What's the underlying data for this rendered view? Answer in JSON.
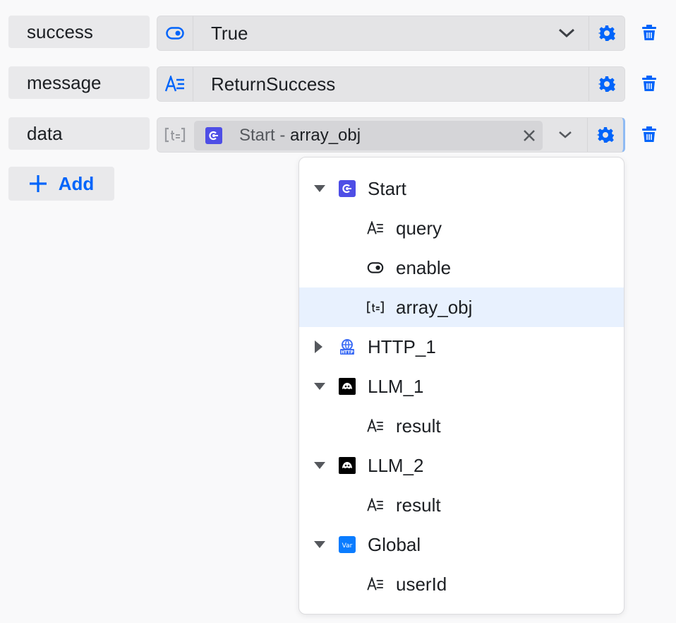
{
  "rows": [
    {
      "name": "success",
      "type_icon": "boolean-toggle-icon",
      "value": "True"
    },
    {
      "name": "message",
      "type_icon": "string-type-icon",
      "value": "ReturnSuccess"
    },
    {
      "name": "data",
      "type_icon": "array-object-icon",
      "ref_node": "Start - ",
      "ref_var": "array_obj"
    }
  ],
  "add_label": "Add",
  "tree": {
    "start": {
      "label": "Start",
      "icon": "start-node-icon",
      "expanded": true,
      "children": [
        {
          "label": "query",
          "icon": "string-type-icon"
        },
        {
          "label": "enable",
          "icon": "boolean-toggle-icon"
        },
        {
          "label": "array_obj",
          "icon": "array-object-icon",
          "selected": true
        }
      ]
    },
    "http": {
      "label": "HTTP_1",
      "icon": "http-node-icon",
      "expanded": false
    },
    "llm1": {
      "label": "LLM_1",
      "icon": "llm-node-icon",
      "expanded": true,
      "children": [
        {
          "label": "result",
          "icon": "string-type-icon"
        }
      ]
    },
    "llm2": {
      "label": "LLM_2",
      "icon": "llm-node-icon",
      "expanded": true,
      "children": [
        {
          "label": "result",
          "icon": "string-type-icon"
        }
      ]
    },
    "global": {
      "label": "Global",
      "icon": "var-node-icon",
      "icon_text": "Var",
      "expanded": true,
      "children": [
        {
          "label": "userId",
          "icon": "string-type-icon"
        }
      ]
    }
  },
  "colors": {
    "accent": "#0064fa",
    "node_purple": "#4e4ee6",
    "selected_bg": "#e8f1fe"
  }
}
